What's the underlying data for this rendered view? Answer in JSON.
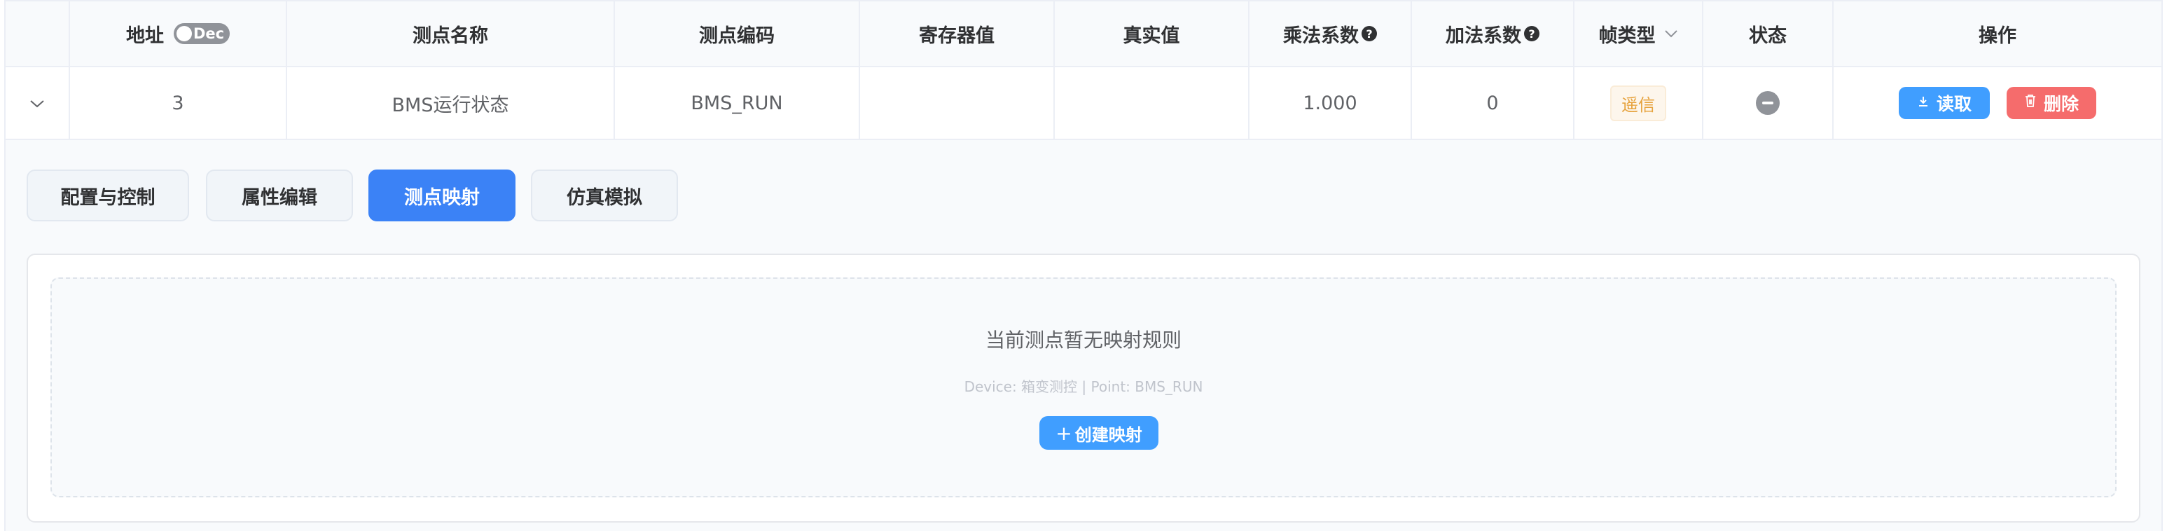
{
  "table": {
    "headers": {
      "address": "地址",
      "address_toggle": "Dec",
      "point_name": "测点名称",
      "point_code": "测点编码",
      "register_value": "寄存器值",
      "real_value": "真实值",
      "multiplier": "乘法系数",
      "addend": "加法系数",
      "frame_type": "帧类型",
      "status": "状态",
      "actions": "操作"
    },
    "row": {
      "address": "3",
      "point_name": "BMS运行状态",
      "point_code": "BMS_RUN",
      "register_value": "",
      "real_value": "",
      "multiplier": "1.000",
      "addend": "0",
      "frame_type": "遥信",
      "read_label": "读取",
      "delete_label": "删除"
    }
  },
  "tabs": [
    {
      "label": "配置与控制",
      "active": false
    },
    {
      "label": "属性编辑",
      "active": false
    },
    {
      "label": "测点映射",
      "active": true
    },
    {
      "label": "仿真模拟",
      "active": false
    }
  ],
  "mapping": {
    "empty_title": "当前测点暂无映射规则",
    "empty_subtitle": "Device: 箱变测控 | Point: BMS_RUN",
    "create_label": "创建映射"
  },
  "colors": {
    "primary": "#409eff",
    "tab_active": "#3b82f6",
    "danger": "#f56c6c",
    "warning_tag": "#e6a23c",
    "status_gray": "#909399"
  },
  "icons": {
    "expand": "chevron-down-icon",
    "help": "question-circle-icon",
    "filter": "chevron-down-icon",
    "status": "minus-circle-icon",
    "read": "download-icon",
    "delete": "trash-icon",
    "create": "plus-icon"
  }
}
